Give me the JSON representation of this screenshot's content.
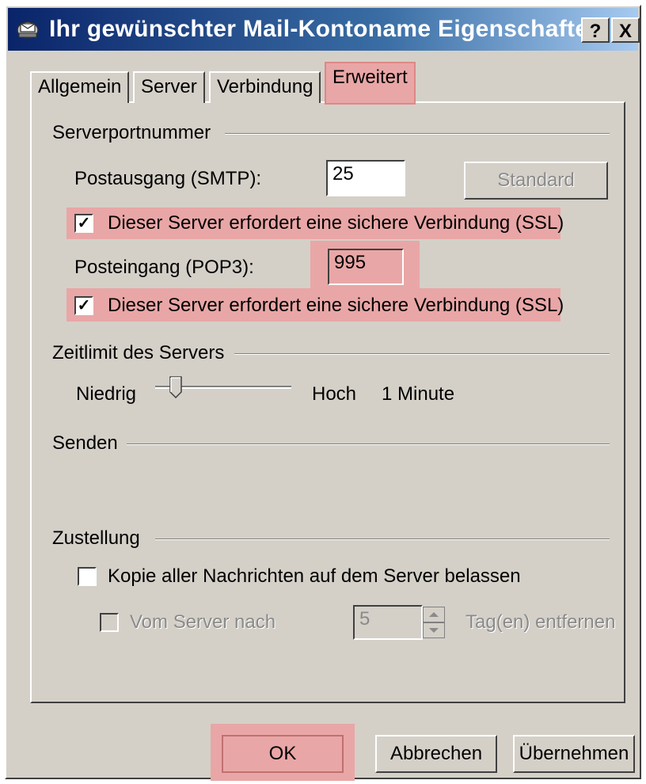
{
  "window": {
    "title": "Ihr gewünschter Mail-Kontoname Eigenschaften",
    "help_label": "?",
    "close_label": "X"
  },
  "tabs": [
    {
      "label": "Allgemein"
    },
    {
      "label": "Server"
    },
    {
      "label": "Verbindung"
    },
    {
      "label": "Erweitert",
      "active": true
    }
  ],
  "server_ports": {
    "group_label": "Serverportnummer",
    "smtp_label": "Postausgang (SMTP):",
    "smtp_value": "25",
    "standard_button": "Standard",
    "smtp_ssl_label": "Dieser Server erfordert eine sichere Verbindung (SSL)",
    "smtp_ssl_checked": true,
    "pop3_label": "Posteingang (POP3):",
    "pop3_value": "995",
    "pop3_ssl_label": "Dieser Server erfordert eine sichere Verbindung (SSL)",
    "pop3_ssl_checked": true
  },
  "timeout": {
    "group_label": "Zeitlimit des Servers",
    "low_label": "Niedrig",
    "high_label": "Hoch",
    "value_label": "1 Minute",
    "slider_level": 0.12
  },
  "send": {
    "group_label": "Senden"
  },
  "delivery": {
    "group_label": "Zustellung",
    "keep_copy_label": "Kopie aller Nachrichten auf dem Server belassen",
    "keep_copy_checked": false,
    "remove_after_label": "Vom Server nach",
    "remove_after_days": "5",
    "days_suffix": "Tag(en) entfernen"
  },
  "footer": {
    "ok_label": "OK",
    "cancel_label": "Abbrechen",
    "apply_label": "Übernehmen"
  },
  "colors": {
    "highlight": "#e9a6a6",
    "dialog_bg": "#d4d0c8"
  }
}
